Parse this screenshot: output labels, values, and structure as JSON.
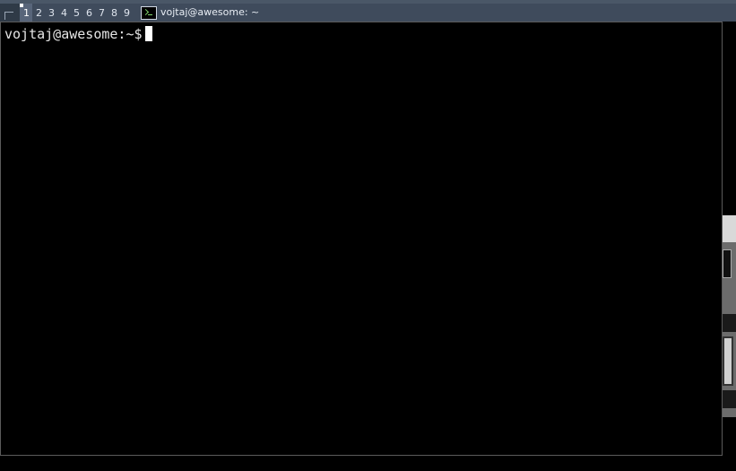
{
  "taglist": [
    "1",
    "2",
    "3",
    "4",
    "5",
    "6",
    "7",
    "8",
    "9"
  ],
  "active_tag": "1",
  "task": {
    "title": "vojtaj@awesome: ~",
    "icon": "terminal-icon"
  },
  "terminal": {
    "prompt": "vojtaj@awesome:~$"
  },
  "colors": {
    "bar": "#3f4b5c",
    "active_tag": "#58657a",
    "terminal_bg": "#000000"
  }
}
